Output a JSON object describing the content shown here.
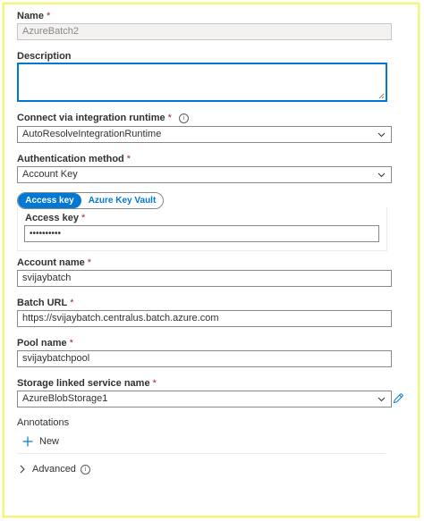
{
  "form": {
    "name": {
      "label": "Name",
      "required": "*",
      "value": "AzureBatch2"
    },
    "description": {
      "label": "Description",
      "value": ""
    },
    "runtime": {
      "label": "Connect via integration runtime",
      "required": "*",
      "info": "i",
      "value": "AutoResolveIntegrationRuntime"
    },
    "auth": {
      "label": "Authentication method",
      "required": "*",
      "value": "Account Key"
    },
    "toggle": {
      "active": "Access key",
      "inactive": "Azure Key Vault"
    },
    "access_key": {
      "label": "Access key",
      "required": "*",
      "value": "••••••••••"
    },
    "account_name": {
      "label": "Account name",
      "required": "*",
      "value": "svijaybatch"
    },
    "batch_url": {
      "label": "Batch URL",
      "required": "*",
      "value": "https://svijaybatch.centralus.batch.azure.com"
    },
    "pool_name": {
      "label": "Pool name",
      "required": "*",
      "value": "svijaybatchpool"
    },
    "storage": {
      "label": "Storage linked service name",
      "required": "*",
      "value": "AzureBlobStorage1"
    },
    "annotations": {
      "label": "Annotations",
      "new_label": "New"
    },
    "advanced": {
      "label": "Advanced",
      "info": "i"
    }
  },
  "colors": {
    "accent": "#0078d4",
    "required": "#a4262c",
    "border": "#8a8886",
    "frame": "#f7f47a"
  },
  "icons": [
    "info-icon",
    "chevron-down-icon",
    "pencil-icon",
    "plus-icon",
    "chevron-right-icon",
    "resize-grip-icon"
  ]
}
